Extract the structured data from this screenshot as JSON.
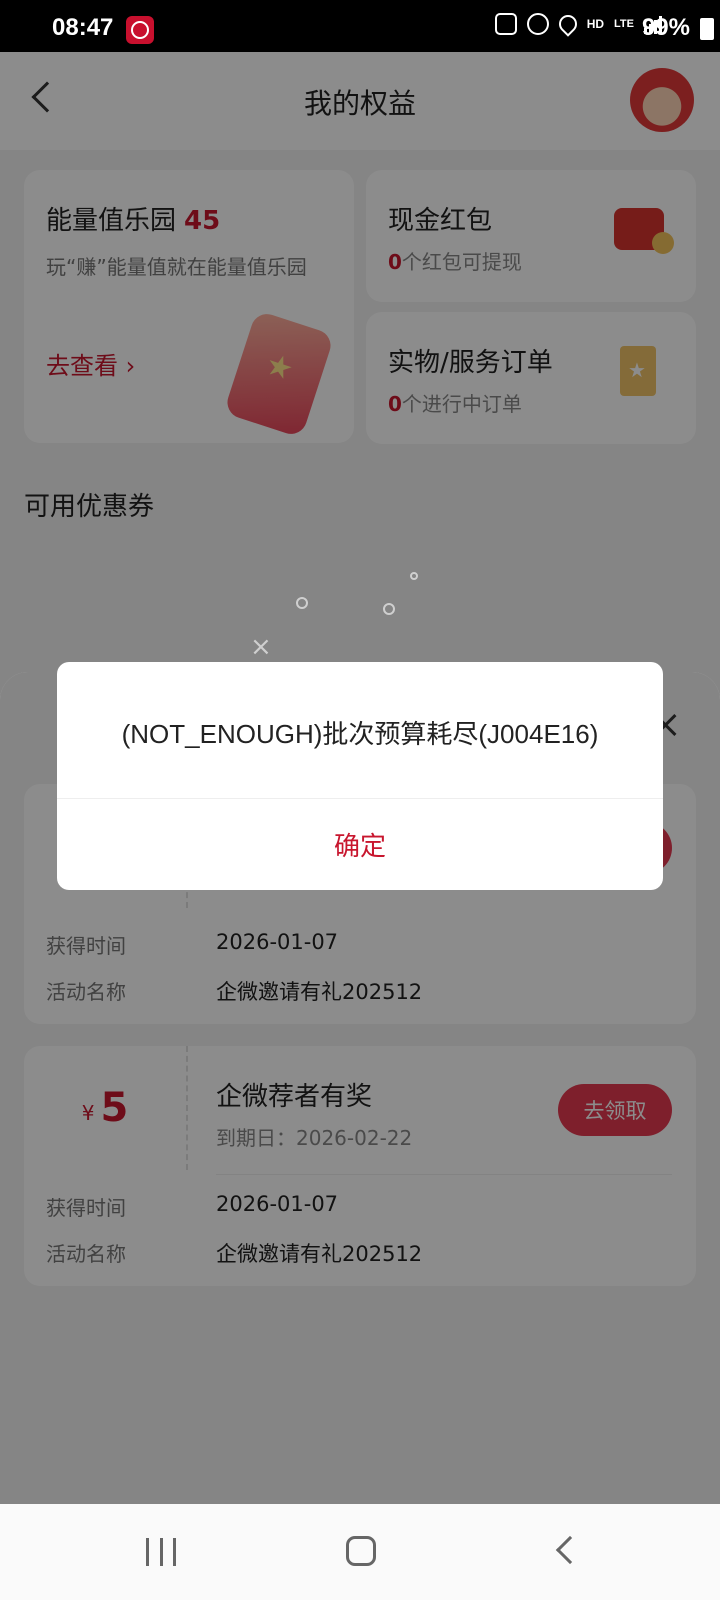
{
  "status_bar": {
    "time": "08:47",
    "network_hd": "HD",
    "network_lte": "LTE",
    "battery": "99%"
  },
  "header": {
    "title": "我的权益"
  },
  "energy_card": {
    "title": "能量值乐园",
    "value": "45",
    "description": "玩“赚”能量值就在能量值乐园",
    "link": "去查看 ›"
  },
  "cash_card": {
    "title": "现金红包",
    "count": "0",
    "suffix": "个红包可提现"
  },
  "order_card": {
    "title": "实物/服务订单",
    "count": "0",
    "suffix": "个进行中订单"
  },
  "coupons_section": {
    "title": "可用优惠券"
  },
  "coupons": [
    {
      "obtained_label": "获得时间",
      "obtained_value": "2026-01-07",
      "activity_label": "活动名称",
      "activity_value": "企微邀请有礼202512"
    },
    {
      "currency": "¥",
      "amount": "5",
      "name": "企微荐者有奖",
      "expiry": "到期日：2026-02-22",
      "button": "去领取",
      "obtained_label": "获得时间",
      "obtained_value": "2026-01-07",
      "activity_label": "活动名称",
      "activity_value": "企微邀请有礼202512"
    }
  ],
  "dialog": {
    "message": "(NOT_ENOUGH)批次预算耗尽(J004E16)",
    "confirm": "确定"
  },
  "colors": {
    "accent": "#c8162e",
    "button": "#e63950"
  }
}
